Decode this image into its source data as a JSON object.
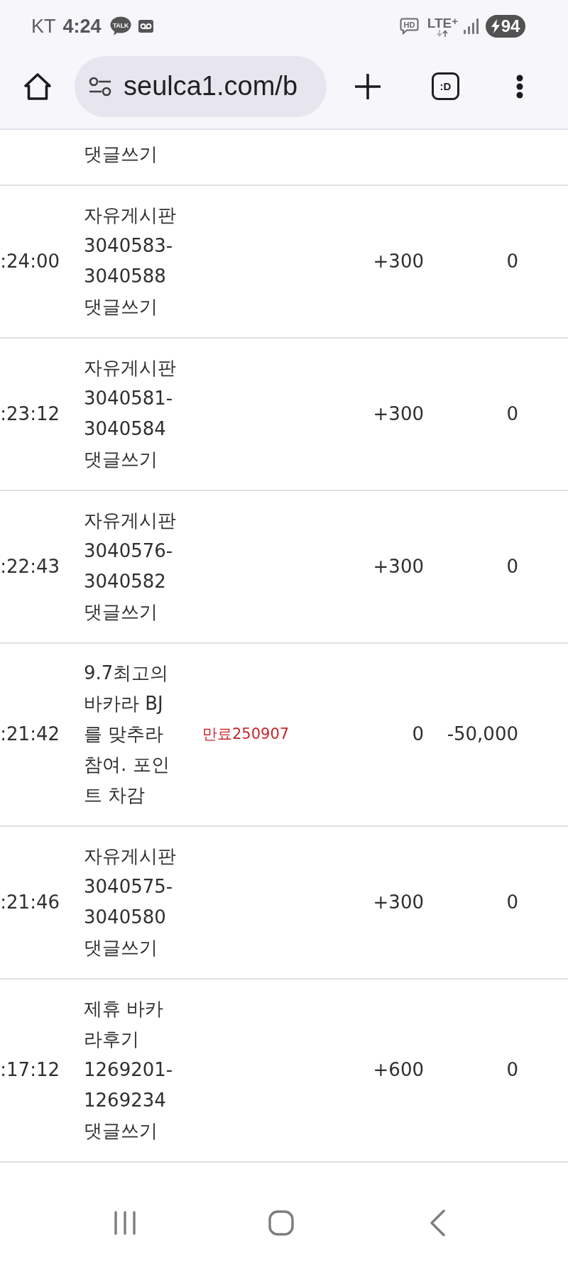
{
  "status_bar": {
    "carrier": "KT",
    "time": "4:24",
    "notifications": [
      {
        "kind": "talk",
        "label": "TALK"
      },
      {
        "kind": "voicemail"
      }
    ],
    "call_quality": "HD",
    "network": "LTE$^{+}$",
    "battery": "94"
  },
  "browser_toolbar": {
    "url": "seulca1.com/b",
    "tab_switcher": ":D"
  },
  "table": {
    "rows": [
      {
        "description": "댓글쓰기"
      },
      {
        "time": ":24:00",
        "description": "자유게시판\n3040583-\n3040588\n댓글쓰기",
        "points": "+300",
        "balance": "0"
      },
      {
        "time": ":23:12",
        "description": "자유게시판\n3040581-\n3040584\n댓글쓰기",
        "points": "+300",
        "balance": "0"
      },
      {
        "time": ":22:43",
        "description": "자유게시판\n3040576-\n3040582\n댓글쓰기",
        "points": "+300",
        "balance": "0"
      },
      {
        "time": ":21:42",
        "description": "9.7최고의\n바카라 BJ\n를 맞추라\n참여. 포인\n트 차감",
        "note": "만료250907",
        "points": "0",
        "balance": "-50,000"
      },
      {
        "time": ":21:46",
        "description": "자유게시판\n3040575-\n3040580\n댓글쓰기",
        "points": "+300",
        "balance": "0"
      },
      {
        "time": ":17:12",
        "description": "제휴 바카\n라후기\n1269201-\n1269234\n댓글쓰기",
        "points": "+600",
        "balance": "0"
      }
    ]
  }
}
